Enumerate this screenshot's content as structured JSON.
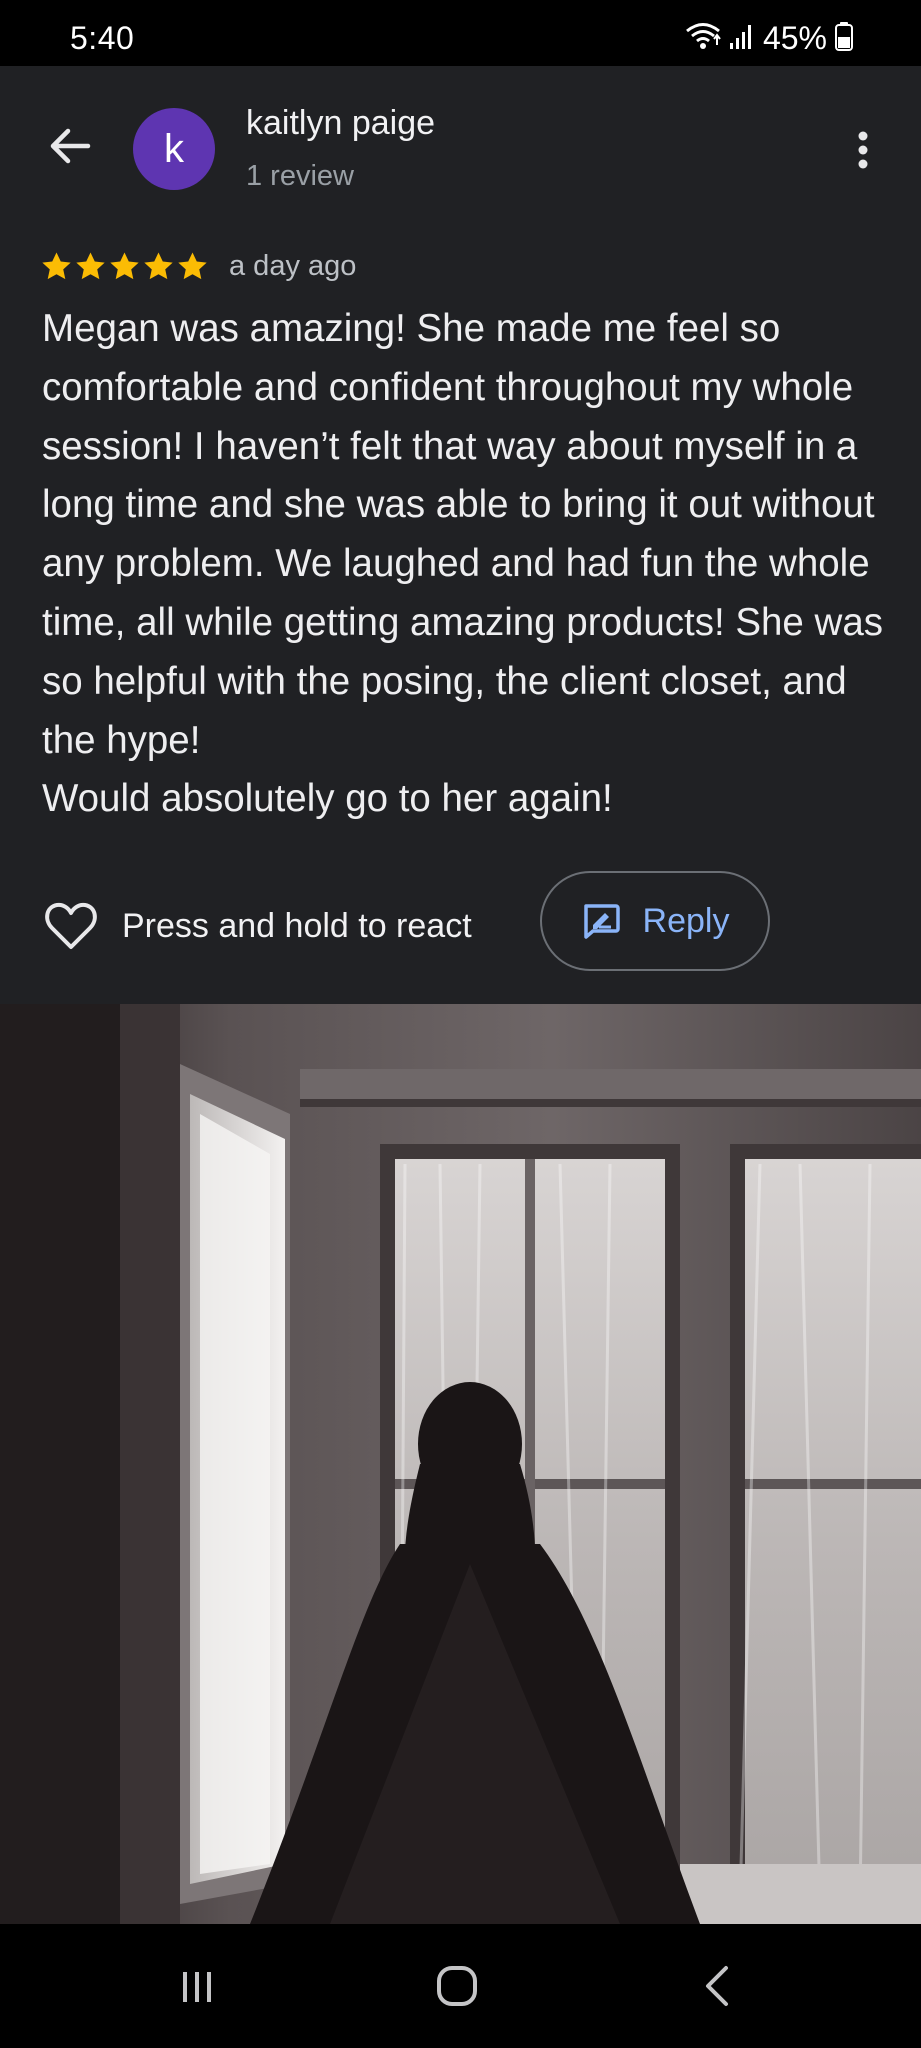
{
  "status_bar": {
    "time": "5:40",
    "battery": "45%",
    "icons": [
      "wifi-icon",
      "signal-icon",
      "battery-icon"
    ]
  },
  "header": {
    "back_icon": "arrow-back-icon",
    "avatar_letter": "k",
    "avatar_color": "#5e35b1",
    "name": "kaitlyn paige",
    "subtitle": "1 review",
    "more_icon": "more-vert-icon"
  },
  "review": {
    "rating": 5,
    "rating_max": 5,
    "star_color": "#fbbc04",
    "time": "a day ago",
    "text": "Megan was amazing! She made me feel so comfortable and confident throughout my whole session! I haven’t felt that way about myself in a long time and she was able to bring it out without any problem. We laughed and had fun the whole time, all while getting amazing products! She was so helpful with the posing, the client closet, and the hype!\nWould absolutely go to her again!"
  },
  "actions": {
    "react_icon": "heart-outline-icon",
    "react_label": "Press and hold to react",
    "reply_icon": "reply-edit-icon",
    "reply_label": "Reply",
    "accent_color": "#8ab4f8"
  },
  "photo": {
    "subject": "review-photo"
  },
  "nav_bar": {
    "icons": [
      "recents-icon",
      "home-icon",
      "back-nav-icon"
    ]
  }
}
